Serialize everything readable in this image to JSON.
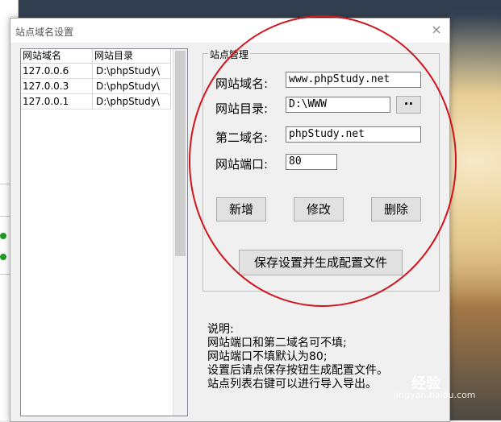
{
  "window": {
    "title": "站点域名设置",
    "close_glyph": "×"
  },
  "site_list": {
    "columns": [
      "网站域名",
      "网站目录"
    ],
    "rows": [
      {
        "domain": "127.0.0.6",
        "dir": "D:\\phpStudy\\"
      },
      {
        "domain": "127.0.0.3",
        "dir": "D:\\phpStudy\\"
      },
      {
        "domain": "127.0.0.1",
        "dir": "D:\\phpStudy\\"
      }
    ]
  },
  "site_management": {
    "group_title": "站点管理",
    "domain_label": "网站域名:",
    "domain_value": "www.phpStudy.net",
    "dir_label": "网站目录:",
    "dir_value": "D:\\WWW",
    "browse_label": "··",
    "second_domain_label": "第二域名:",
    "second_domain_value": "phpStudy.net",
    "port_label": "网站端口:",
    "port_value": "80",
    "add_label": "新增",
    "modify_label": "修改",
    "delete_label": "删除",
    "save_label": "保存设置并生成配置文件"
  },
  "notes": [
    "说明:",
    "网站端口和第二域名可不填;",
    "网站端口不填默认为80;",
    "设置后请点保存按钮生成配置文件。",
    "站点列表右键可以进行导入导出。"
  ],
  "watermark": {
    "text": "经验",
    "sub": "jingyan.baidu.com"
  },
  "colors": {
    "annotation_circle": "#d0141c",
    "status_green": "#1f9a1f"
  }
}
